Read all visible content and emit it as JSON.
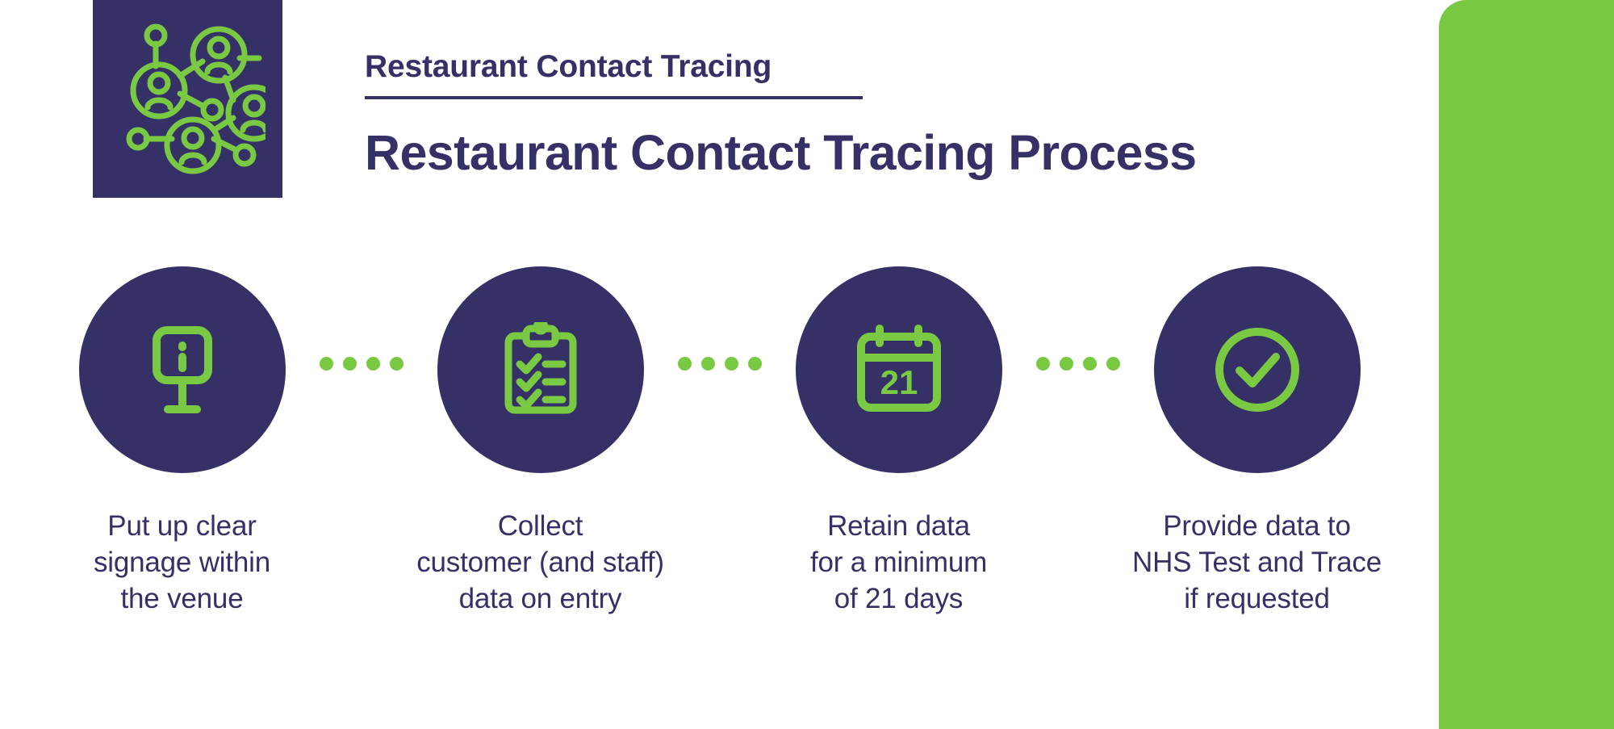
{
  "theme": {
    "navy": "#353167",
    "green": "#7ac943",
    "white": "#ffffff"
  },
  "logo_tile": {
    "icon": "people-network-icon"
  },
  "header": {
    "eyebrow": "Restaurant Contact Tracing",
    "title": "Restaurant Contact Tracing Process"
  },
  "steps": [
    {
      "icon": "information-sign-icon",
      "caption": "Put up clear\nsignage within\nthe venue"
    },
    {
      "icon": "clipboard-checklist-icon",
      "caption": "Collect\ncustomer (and staff)\ndata on entry"
    },
    {
      "icon": "calendar-21-icon",
      "caption": "Retain data\nfor a minimum\nof 21 days",
      "calendar_day": "21"
    },
    {
      "icon": "check-circle-icon",
      "caption": "Provide data to\nNHS Test and Trace\nif requested"
    }
  ],
  "connectors": {
    "dot_count": 4
  },
  "brand_panel": {
    "mark": "wifi-c-logo-icon"
  }
}
